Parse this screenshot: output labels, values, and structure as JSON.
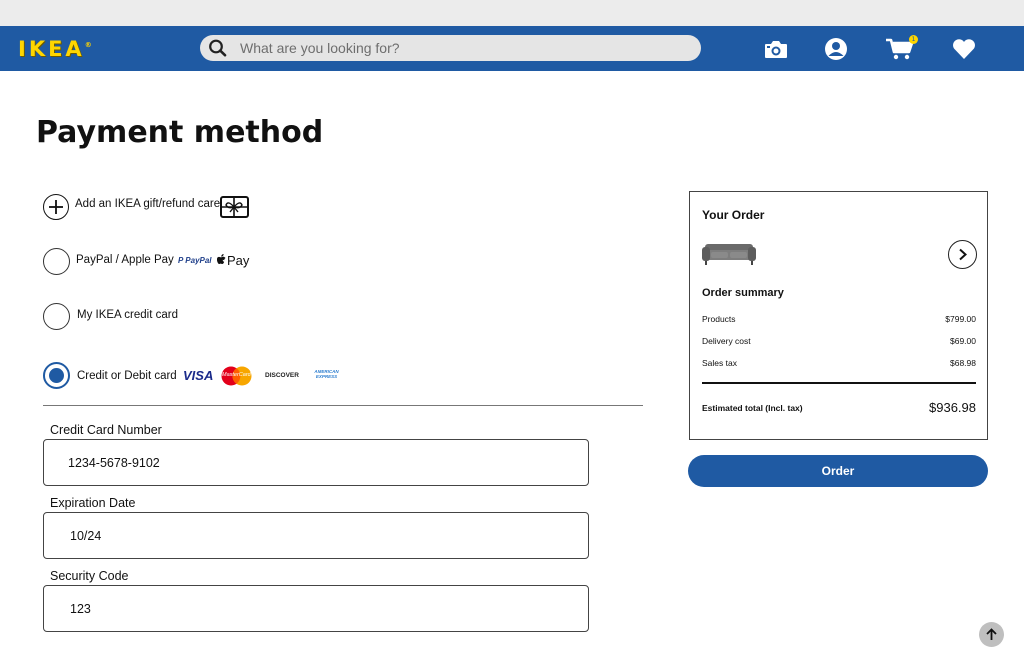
{
  "header": {
    "brand": "IKEA",
    "search_placeholder": "What are you looking for?",
    "icons": [
      "search-icon",
      "camera-icon",
      "account-icon",
      "cart-icon",
      "heart-icon"
    ],
    "cart_count": "1",
    "colors": {
      "nav_bg": "#1f5aa3",
      "brand_yellow": "#ffd600"
    }
  },
  "page": {
    "title": "Payment method"
  },
  "payment_options": {
    "gift_card": {
      "label": "Add an IKEA gift/refund care"
    },
    "paypal": {
      "label": "PayPal / Apple Pay",
      "logos": [
        "PayPal",
        "Pay"
      ]
    },
    "ikea_credit": {
      "label": "My IKEA credit card"
    },
    "card": {
      "label": "Credit or Debit card",
      "logos": [
        "VISA",
        "MasterCard",
        "DISCOVER",
        "AMERICAN EXPRESS"
      ],
      "selected": true
    }
  },
  "form": {
    "card_number": {
      "label": "Credit Card Number",
      "value": "1234-5678-9102"
    },
    "expiration": {
      "label": "Expiration Date",
      "value": "10/24"
    },
    "security": {
      "label": "Security Code",
      "value": "123"
    }
  },
  "order": {
    "title": "Your Order",
    "summary_title": "Order summary",
    "rows": [
      {
        "label": "Products",
        "value": "$799.00"
      },
      {
        "label": "Delivery cost",
        "value": "$69.00"
      },
      {
        "label": "Sales tax",
        "value": "$68.98"
      }
    ],
    "total_label": "Estimated total (Incl. tax)",
    "total_value": "$936.98",
    "button_label": "Order"
  }
}
